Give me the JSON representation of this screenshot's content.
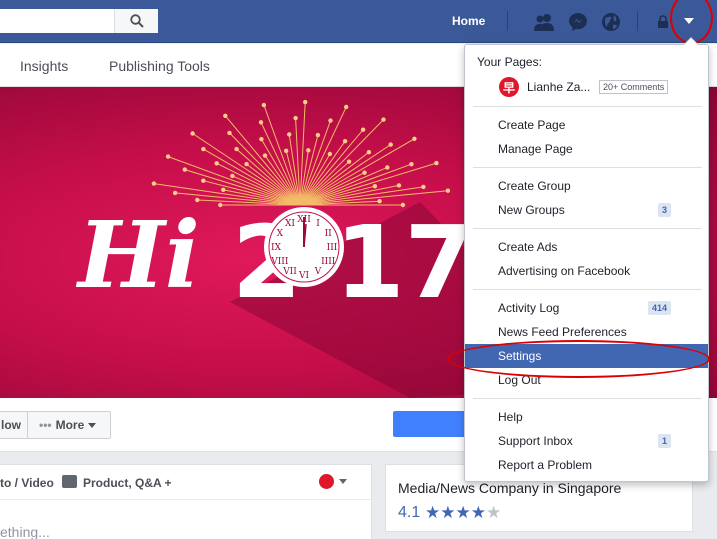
{
  "topbar": {
    "search_placeholder": "",
    "home_label": "Home",
    "icons": [
      "search-icon",
      "friends-icon",
      "messenger-icon",
      "globe-icon",
      "lock-icon",
      "caret-down-icon"
    ]
  },
  "page_nav": {
    "tabs": [
      "Insights",
      "Publishing Tools"
    ]
  },
  "cover": {
    "text_hi": "Hi",
    "text_2": "2",
    "text_17": "17"
  },
  "actions": {
    "follow_label": "low",
    "more_label": "More"
  },
  "composer": {
    "options": [
      "to / Video",
      "Product, Q&A +"
    ],
    "placeholder": "ething..."
  },
  "about": {
    "category": "Media/News Company in Singapore",
    "rating": "4.1",
    "stars": "★★★★★"
  },
  "dropdown": {
    "your_pages_label": "Your Pages:",
    "page": {
      "logo_char": "早",
      "name": "Lianhe Za...",
      "badge": "20+ Comments"
    },
    "items": [
      {
        "label": "Create Page"
      },
      {
        "label": "Manage Page"
      },
      {
        "label": "Create Group"
      },
      {
        "label": "New Groups",
        "count": "3"
      },
      {
        "label": "Create Ads"
      },
      {
        "label": "Advertising on Facebook"
      },
      {
        "label": "Activity Log",
        "count": "414"
      },
      {
        "label": "News Feed Preferences"
      },
      {
        "label": "Settings"
      },
      {
        "label": "Log Out"
      },
      {
        "label": "Help"
      },
      {
        "label": "Support Inbox",
        "count": "1"
      },
      {
        "label": "Report a Problem"
      }
    ]
  },
  "colors": {
    "brand": "#3b5998",
    "active": "#4267b2",
    "annotation": "#dd0000"
  }
}
